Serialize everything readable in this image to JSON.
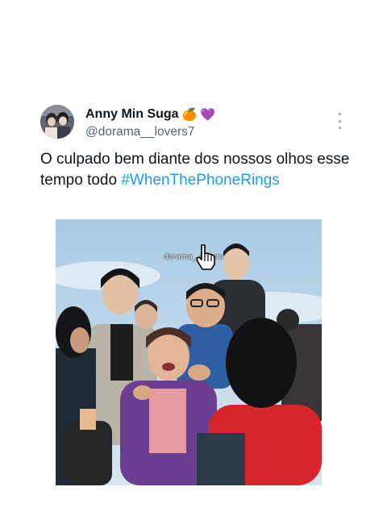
{
  "tweet": {
    "display_name": "Anny Min Suga",
    "emoji_1": "🍊",
    "emoji_2": "💜",
    "handle": "@dorama__lovers7",
    "text_main": "O culpado bem diante dos nossos olhos esse tempo todo ",
    "hashtag": "#WhenThePhoneRings"
  },
  "media": {
    "watermark": "dorama__lovers",
    "cursor_icon": "hand-pointer-icon"
  },
  "colors": {
    "hashtag": "#1d9bf0",
    "handle": "#536471",
    "text": "#0f1419"
  }
}
